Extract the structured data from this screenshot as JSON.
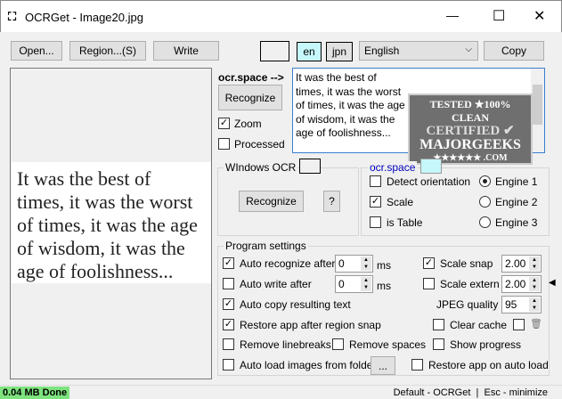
{
  "window": {
    "title": "OCRGet - Image20.jpg",
    "minimize": "—",
    "maximize": "☐",
    "close": "✕"
  },
  "toolbar": {
    "open": "Open...",
    "region": "Region...(S)",
    "write": "Write",
    "lang_en": "en",
    "lang_jpn": "jpn",
    "language": "English",
    "copy": "Copy"
  },
  "image_text": [
    "It was the best of",
    "times, it was the worst",
    "of times, it was the age",
    "of wisdom, it was the",
    "age of foolishness..."
  ],
  "ocr_space_label": "ocr.space -->",
  "recognize": "Recognize",
  "zoom": "Zoom",
  "processed": "Processed",
  "result_text": "It was the best of\ntimes, it was the worst\nof times, it was the age\nof wisdom, it was the\nage of foolishness...",
  "badge": {
    "line1": "TESTED ★100% CLEAN",
    "line2": "CERTIFIED",
    "line3": "MAJORGEEKS",
    "line4": "★★★★★★ .COM"
  },
  "windows_ocr": {
    "title": "WIndows OCR",
    "recognize": "Recognize",
    "help": "?"
  },
  "ocrspace": {
    "title": "ocr.space",
    "detect": "Detect orientation",
    "scale": "Scale",
    "table": "is Table",
    "engine1": "Engine 1",
    "engine2": "Engine 2",
    "engine3": "Engine 3"
  },
  "settings": {
    "title": "Program settings",
    "auto_recognize": "Auto recognize after",
    "auto_recognize_val": "0",
    "ms": "ms",
    "auto_write": "Auto write after",
    "auto_write_val": "0",
    "scale_snap": "Scale snap",
    "scale_snap_val": "2.00",
    "scale_extern": "Scale extern",
    "scale_extern_val": "2.00",
    "auto_copy": "Auto copy resulting text",
    "jpeg": "JPEG quality",
    "jpeg_val": "95",
    "restore_snap": "Restore app after region snap",
    "clear_cache": "Clear cache",
    "remove_lb": "Remove linebreaks",
    "remove_sp": "Remove spaces",
    "show_progress": "Show progress",
    "auto_load": "Auto load images from folder",
    "browse": "...",
    "restore_auto": "Restore app on auto load"
  },
  "status": {
    "left": "0.04 MB Done",
    "right": "Default - OCRGet  |  Esc - minimize"
  },
  "colors": {
    "cyan": "#c6f7fb",
    "green": "#7ee37e",
    "blue_label": "#0000c0"
  }
}
